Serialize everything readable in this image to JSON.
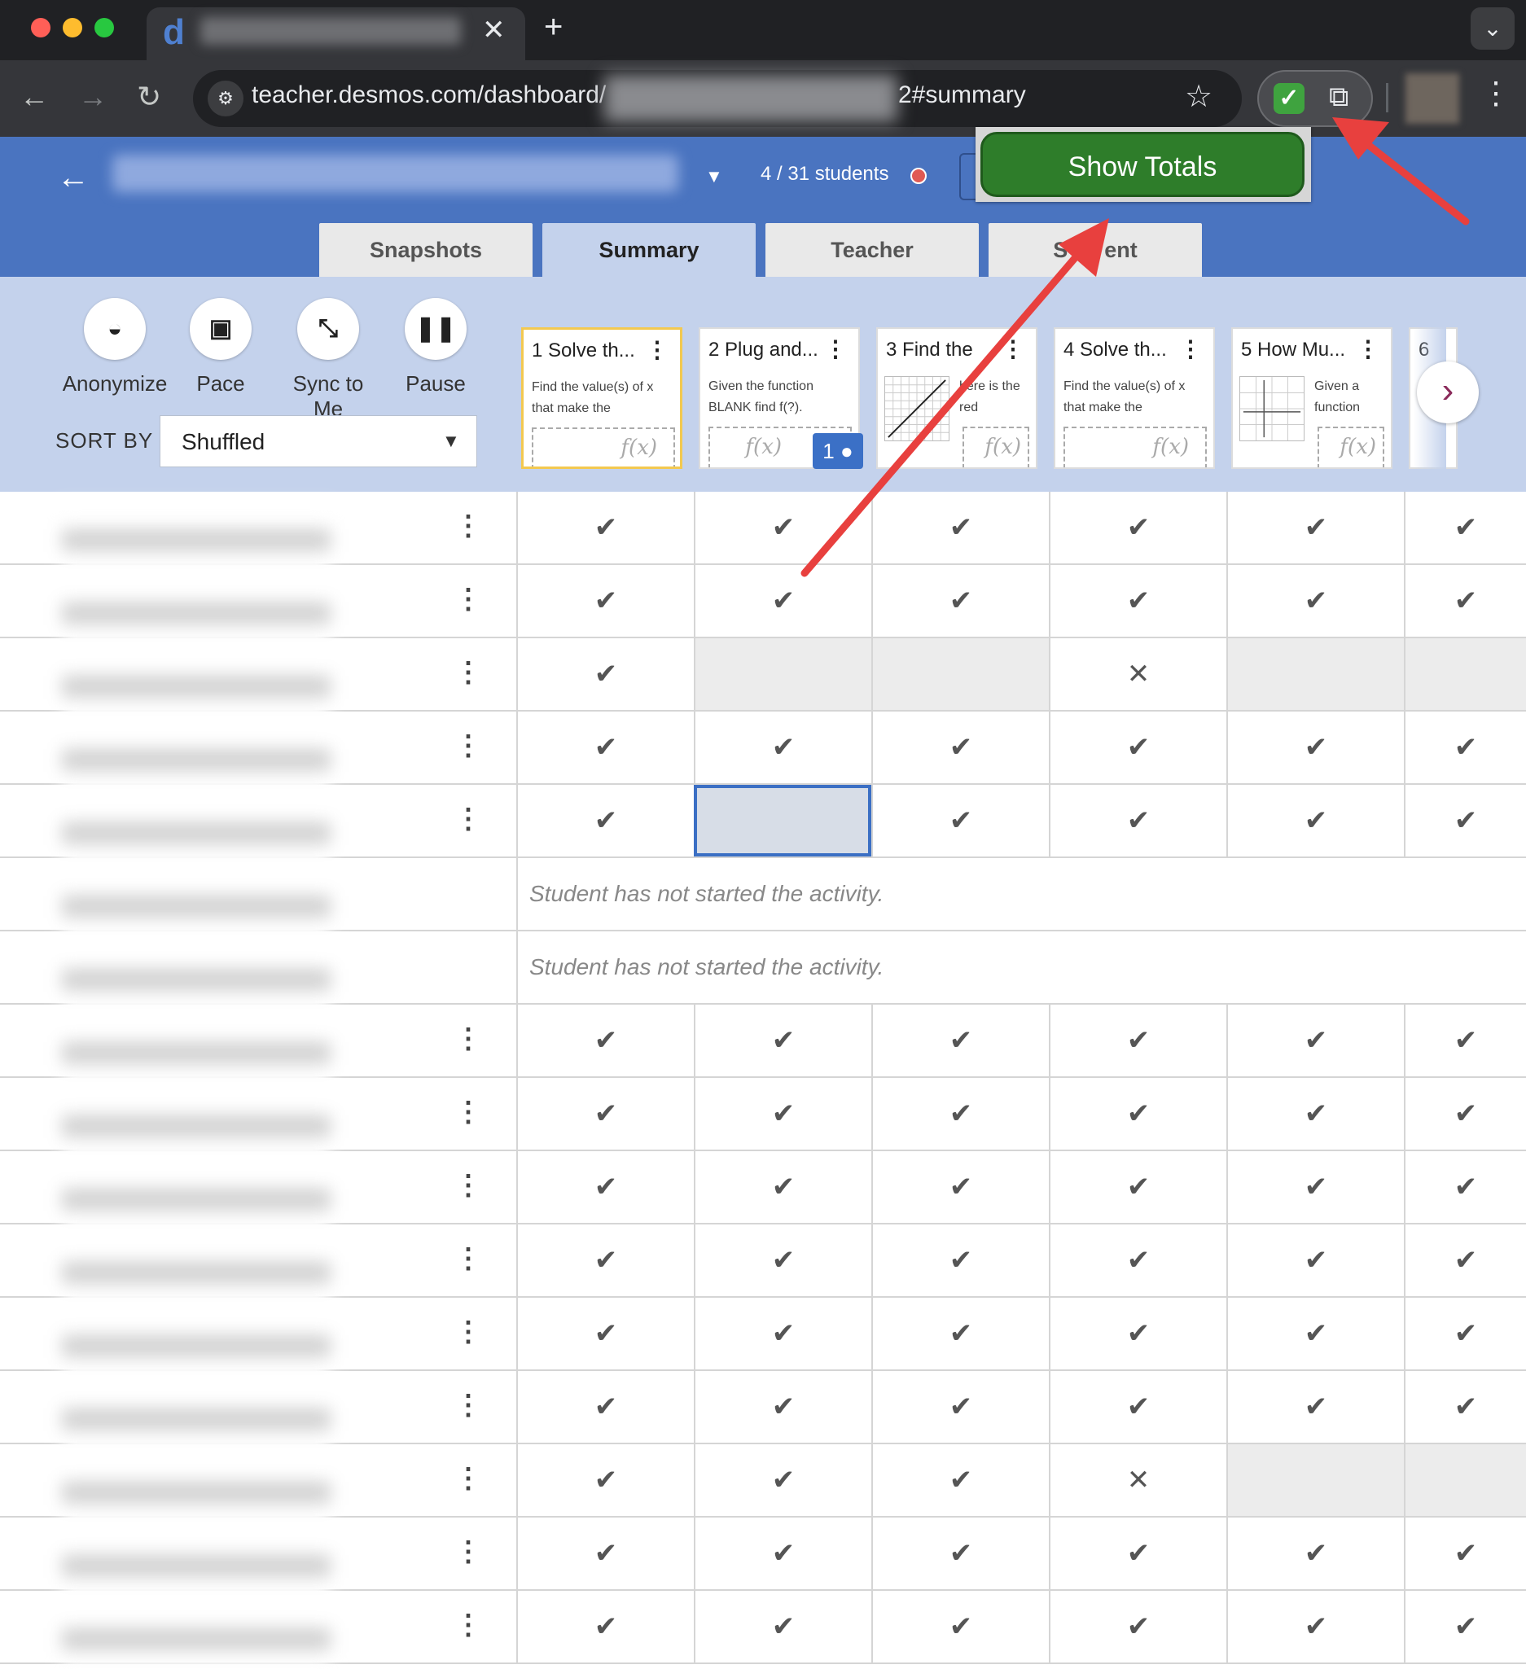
{
  "browser": {
    "favicon_letter": "d",
    "url_left": "teacher.desmos.com/dashboard/",
    "url_right": "2#summary"
  },
  "extension": {
    "popup_button": "Show Totals",
    "icon_color": "#2e7d2a"
  },
  "header": {
    "student_count": "4 / 31 students",
    "tabs": [
      {
        "label": "Snapshots"
      },
      {
        "label": "Summary"
      },
      {
        "label": "Teacher"
      },
      {
        "label": "S      ent"
      }
    ]
  },
  "controls": {
    "buttons": [
      {
        "label": "Anonymize",
        "icon": "incognito-icon"
      },
      {
        "label": "Pace",
        "icon": "pace-icon"
      },
      {
        "label": "Sync to Me",
        "icon": "sync-icon"
      },
      {
        "label": "Pause",
        "icon": "pause-icon"
      }
    ],
    "sort_label": "SORT BY",
    "sort_value": "Shuffled"
  },
  "screens": [
    {
      "num": "1",
      "title": "Solve th...",
      "desc": "Find the value(s) of x that make the",
      "fx": "f(x)"
    },
    {
      "num": "2",
      "title": "Plug and...",
      "desc": "Given the function BLANK find f(?).",
      "fx": "f(x)",
      "badge": "1"
    },
    {
      "num": "3",
      "title": "Find the",
      "desc": "here is the red",
      "fx": "f(x)"
    },
    {
      "num": "4",
      "title": "Solve th...",
      "desc": "Find the value(s) of x that make the",
      "fx": "f(x)"
    },
    {
      "num": "5",
      "title": "How Mu...",
      "desc": "Given a function",
      "fx": "f(x)"
    },
    {
      "num": "6",
      "title": "",
      "desc": "",
      "fx": ""
    }
  ],
  "rows": [
    {
      "cells": [
        "check",
        "check",
        "check",
        "check",
        "check",
        "check"
      ]
    },
    {
      "cells": [
        "check",
        "check",
        "check",
        "check",
        "check",
        "check"
      ]
    },
    {
      "cells": [
        "check",
        "empty",
        "empty",
        "x",
        "empty",
        "empty"
      ]
    },
    {
      "cells": [
        "check",
        "check",
        "check",
        "check",
        "check",
        "check"
      ]
    },
    {
      "cells": [
        "check",
        "focus",
        "check",
        "check",
        "check",
        "check"
      ]
    },
    {
      "message": "Student has not started the activity."
    },
    {
      "message": "Student has not started the activity."
    },
    {
      "cells": [
        "check",
        "check",
        "check",
        "check",
        "check",
        "check"
      ]
    },
    {
      "cells": [
        "check",
        "check",
        "check",
        "check",
        "check",
        "check"
      ]
    },
    {
      "cells": [
        "check",
        "check",
        "check",
        "check",
        "check",
        "check"
      ]
    },
    {
      "cells": [
        "check",
        "check",
        "check",
        "check",
        "check",
        "check"
      ]
    },
    {
      "cells": [
        "check",
        "check",
        "check",
        "check",
        "check",
        "check"
      ]
    },
    {
      "cells": [
        "check",
        "check",
        "check",
        "check",
        "check",
        "check"
      ]
    },
    {
      "cells": [
        "check",
        "check",
        "check",
        "x",
        "empty",
        "empty"
      ]
    },
    {
      "cells": [
        "check",
        "check",
        "check",
        "check",
        "check",
        "check"
      ]
    },
    {
      "cells": [
        "check",
        "check",
        "check",
        "check",
        "check",
        "check"
      ]
    }
  ],
  "glyphs": {
    "check": "✔",
    "x": "✕",
    "empty": "",
    "focus": ""
  }
}
